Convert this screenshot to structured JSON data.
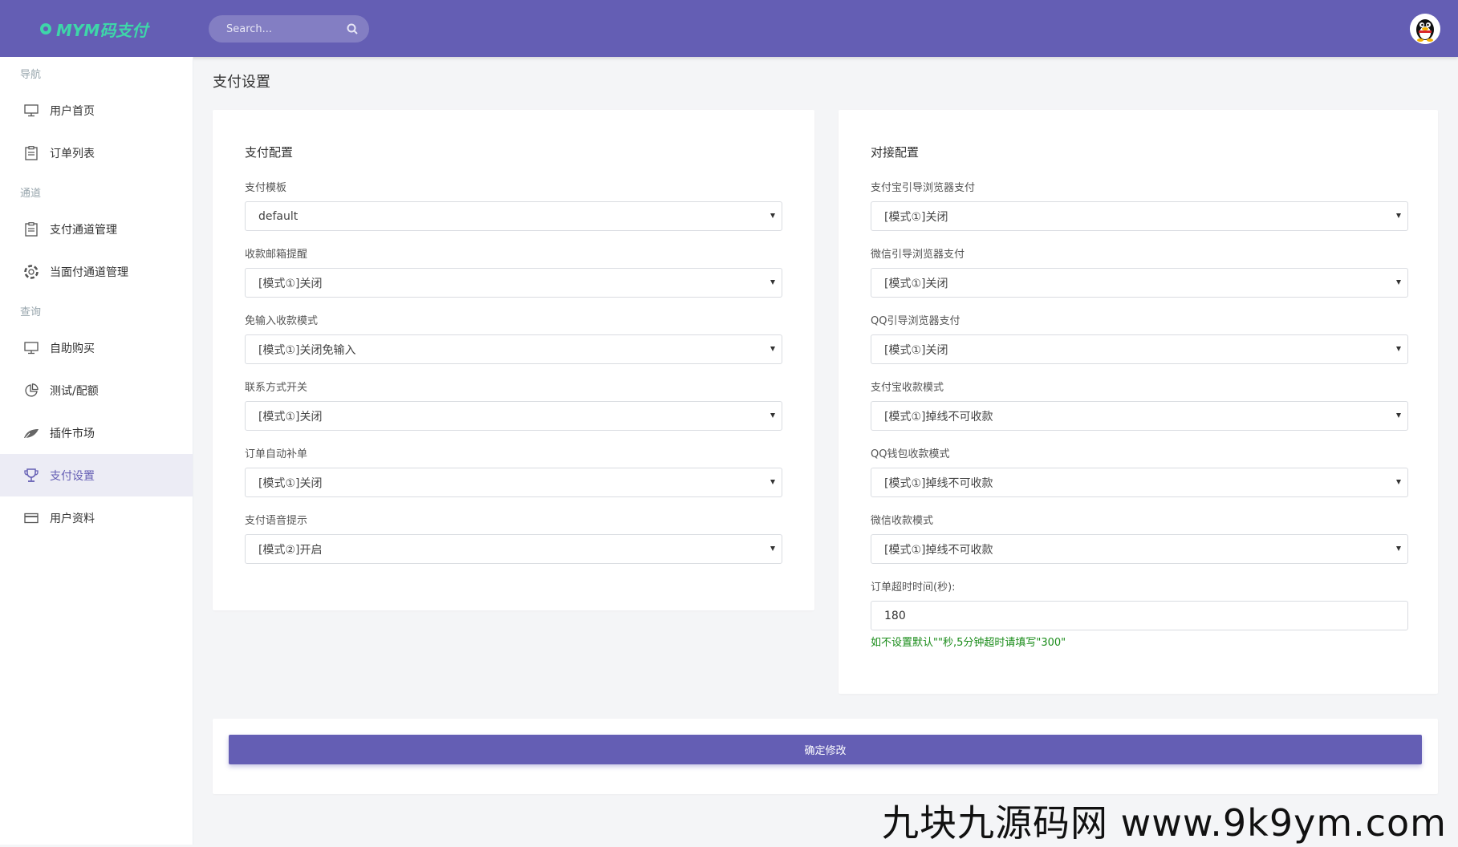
{
  "header": {
    "logo_text": "MYM码支付",
    "search_placeholder": "Search..."
  },
  "sidebar": {
    "sections": [
      {
        "title": "导航",
        "items": [
          {
            "label": "用户首页",
            "icon": "monitor-icon"
          },
          {
            "label": "订单列表",
            "icon": "clipboard-icon"
          }
        ]
      },
      {
        "title": "通道",
        "items": [
          {
            "label": "支付通道管理",
            "icon": "clipboard-icon"
          },
          {
            "label": "当面付通道管理",
            "icon": "lifebuoy-icon"
          }
        ]
      },
      {
        "title": "查询",
        "items": [
          {
            "label": "自助购买",
            "icon": "monitor-icon"
          },
          {
            "label": "测试/配额",
            "icon": "pie-chart-icon"
          },
          {
            "label": "插件市场",
            "icon": "leaf-icon"
          },
          {
            "label": "支付设置",
            "icon": "trophy-icon",
            "active": true
          },
          {
            "label": "用户资料",
            "icon": "credit-card-icon"
          }
        ]
      }
    ]
  },
  "page_title": "支付设置",
  "pay_config": {
    "title": "支付配置",
    "fields": [
      {
        "label": "支付模板",
        "value": "default"
      },
      {
        "label": "收款邮箱提醒",
        "value": "[模式①]关闭"
      },
      {
        "label": "免输入收款模式",
        "value": "[模式①]关闭免输入"
      },
      {
        "label": "联系方式开关",
        "value": "[模式①]关闭"
      },
      {
        "label": "订单自动补单",
        "value": "[模式①]关闭"
      },
      {
        "label": "支付语音提示",
        "value": "[模式②]开启"
      }
    ]
  },
  "dock_config": {
    "title": "对接配置",
    "fields": [
      {
        "label": "支付宝引导浏览器支付",
        "value": "[模式①]关闭"
      },
      {
        "label": "微信引导浏览器支付",
        "value": "[模式①]关闭"
      },
      {
        "label": "QQ引导浏览器支付",
        "value": "[模式①]关闭"
      },
      {
        "label": "支付宝收款模式",
        "value": "[模式①]掉线不可收款"
      },
      {
        "label": "QQ钱包收款模式",
        "value": "[模式①]掉线不可收款"
      },
      {
        "label": "微信收款模式",
        "value": "[模式①]掉线不可收款"
      }
    ],
    "timeout_label": "订单超时时间(秒):",
    "timeout_value": "180",
    "timeout_hint": "如不设置默认\"\"秒,5分钟超时请填写\"300\""
  },
  "submit_label": "确定修改",
  "watermark": "九块九源码网 www.9k9ym.com",
  "colors": {
    "primary": "#645eb4",
    "logo_green": "#3ed6a9",
    "hint_green": "#1a8c1a"
  }
}
